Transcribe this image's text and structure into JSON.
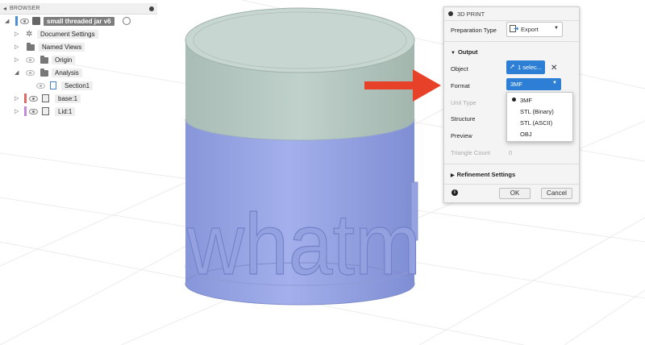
{
  "browser": {
    "title": "BROWSER",
    "items": [
      {
        "label": "small threaded jar v6"
      },
      {
        "label": "Document Settings"
      },
      {
        "label": "Named Views"
      },
      {
        "label": "Origin"
      },
      {
        "label": "Analysis"
      },
      {
        "label": "Section1"
      },
      {
        "label": "base:1"
      },
      {
        "label": "Lid:1"
      }
    ]
  },
  "viewport": {
    "embossed_text": "whatm"
  },
  "dialog": {
    "title": "3D PRINT",
    "preparation_type_label": "Preparation Type",
    "preparation_type_value": "Export",
    "output_section": "Output",
    "object_label": "Object",
    "object_value": "1 selec...",
    "format_label": "Format",
    "format_value": "3MF",
    "unit_type_label": "Unit Type",
    "structure_label": "Structure",
    "preview_label": "Preview",
    "triangle_count_label": "Triangle Count",
    "triangle_count_value": "0",
    "refinement_section": "Refinement Settings",
    "ok_label": "OK",
    "cancel_label": "Cancel"
  },
  "format_dropdown": {
    "options": [
      "3MF",
      "STL (Binary)",
      "STL (ASCII)",
      "OBJ"
    ],
    "selected": "3MF"
  },
  "colors": {
    "dialog_accent": "#2d7fd6",
    "arrow": "#e8412a",
    "jar_body": "#9aa9e6",
    "lid": "#b8cbc3",
    "base_color_tag": "#e06a6a",
    "lid_color_tag": "#c48ad9"
  }
}
